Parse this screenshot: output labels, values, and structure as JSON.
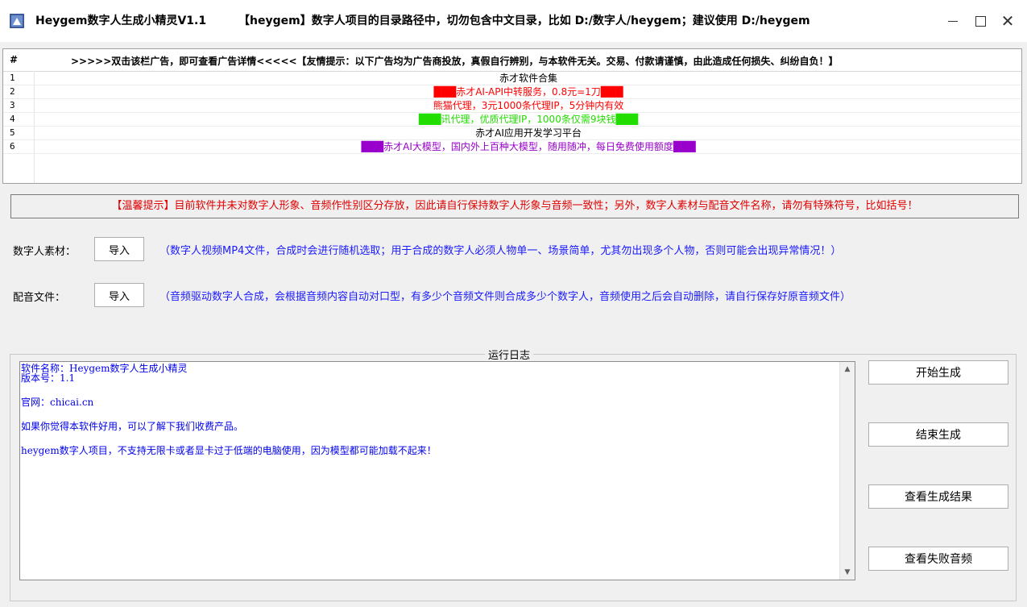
{
  "window": {
    "title": "Heygem数字人生成小精灵V1.1",
    "warning": "【heygem】数字人项目的目录路径中，切勿包含中文目录，比如  D:/数字人/heygem；建议使用 D:/heygem",
    "controls": {
      "minimize": "—",
      "maximize": "□",
      "close": "✕"
    }
  },
  "ad_table": {
    "header_num": "#",
    "header_text": ">>>>>双击该栏广告，即可查看广告详情<<<<<【友情提示：以下广告均为广告商投放，真假自行辨别，与本软件无关。交易、付款请谨慎，由此造成任何损失、纠纷自负！】",
    "rows": [
      {
        "num": "1",
        "text": "赤才软件合集",
        "color": "#000000"
      },
      {
        "num": "2",
        "text": "███赤才AI-API中转服务，0.8元=1刀███",
        "color": "#ff0000"
      },
      {
        "num": "3",
        "text": "熊猫代理，3元1000条代理IP，5分钟内有效",
        "color": "#ff0000"
      },
      {
        "num": "4",
        "text": "███讯代理，优质代理IP，1000条仅需9块钱███",
        "color": "#22dd00"
      },
      {
        "num": "5",
        "text": "赤才AI应用开发学习平台",
        "color": "#000000"
      },
      {
        "num": "6",
        "text": "███赤才AI大模型，国内外上百种大模型，随用随冲，每日免费使用额度███",
        "color": "#9900cc"
      }
    ]
  },
  "notice": "【温馨提示】目前软件并未对数字人形象、音频作性别区分存放，因此请自行保持数字人形象与音频一致性；另外，数字人素材与配音文件名称，请勿有特殊符号，比如括号！",
  "material": {
    "label": "数字人素材：",
    "button": "导入",
    "hint": "（数字人视频MP4文件，合成时会进行随机选取；用于合成的数字人必须人物单一、场景简单，尤其勿出现多个人物，否则可能会出现异常情况！）"
  },
  "audio": {
    "label": "配音文件：",
    "button": "导入",
    "hint": "（音频驱动数字人合成，会根据音频内容自动对口型，有多少个音频文件则合成多少个数字人，音频使用之后会自动删除，请自行保存好原音频文件）"
  },
  "log": {
    "legend": "运行日志",
    "lines": [
      "软件名称：Heygem数字人生成小精灵",
      "版本号：1.1",
      "官网：chicai.cn",
      "如果你觉得本软件好用，可以了解下我们收费产品。",
      "heygem数字人项目，不支持无限卡或者显卡过于低端的电脑使用，因为模型都可能加载不起来！"
    ]
  },
  "actions": {
    "start": "开始生成",
    "stop": "结束生成",
    "view_results": "查看生成结果",
    "view_failed": "查看失败音频"
  }
}
